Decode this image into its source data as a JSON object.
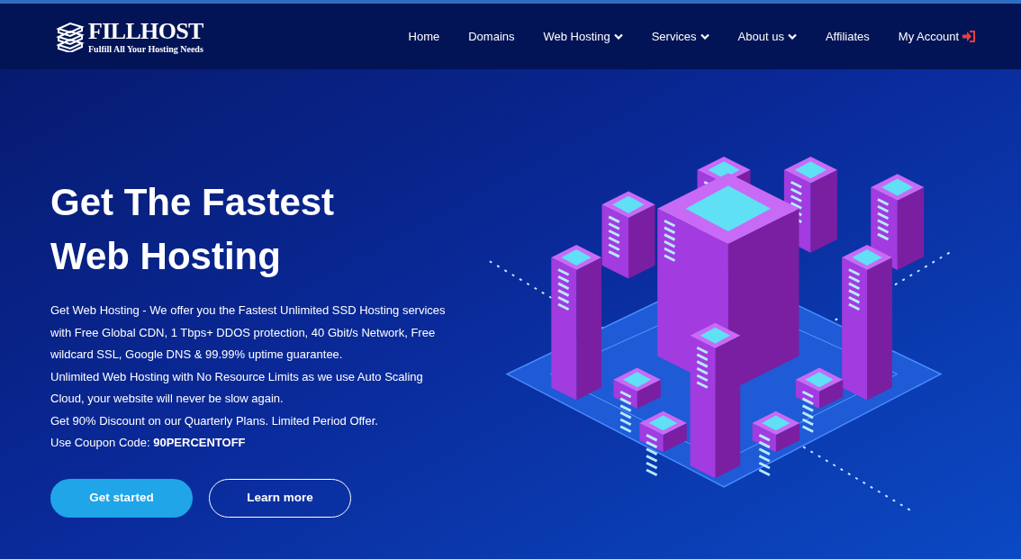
{
  "brand": {
    "name": "FILLHOST",
    "tagline": "Fulfill All Your Hosting Needs"
  },
  "nav": {
    "items": [
      {
        "label": "Home",
        "dropdown": false
      },
      {
        "label": "Domains",
        "dropdown": false
      },
      {
        "label": "Web Hosting",
        "dropdown": true
      },
      {
        "label": "Services",
        "dropdown": true
      },
      {
        "label": "About us",
        "dropdown": true
      },
      {
        "label": "Affiliates",
        "dropdown": false
      }
    ],
    "account": {
      "label": "My Account"
    }
  },
  "hero": {
    "title": "Get The Fastest Web Hosting",
    "paragraphs": [
      "Get Web Hosting - We offer you the Fastest Unlimited SSD Hosting services with Free Global CDN, 1 Tbps+ DDOS protection, 40 Gbit/s Network, Free wildcard SSL, Google DNS & 99.99% uptime guarantee.",
      "Unlimited Web Hosting with No Resource Limits as we use Auto Scaling Cloud, your website will never be slow again.",
      "Get 90% Discount on our Quarterly Plans. Limited Period Offer.",
      "Use Coupon Code: **90PERCENTOFF**"
    ],
    "buttons": [
      {
        "label": "Get started",
        "kind": "primary"
      },
      {
        "label": "Learn more",
        "kind": "outline"
      }
    ]
  }
}
